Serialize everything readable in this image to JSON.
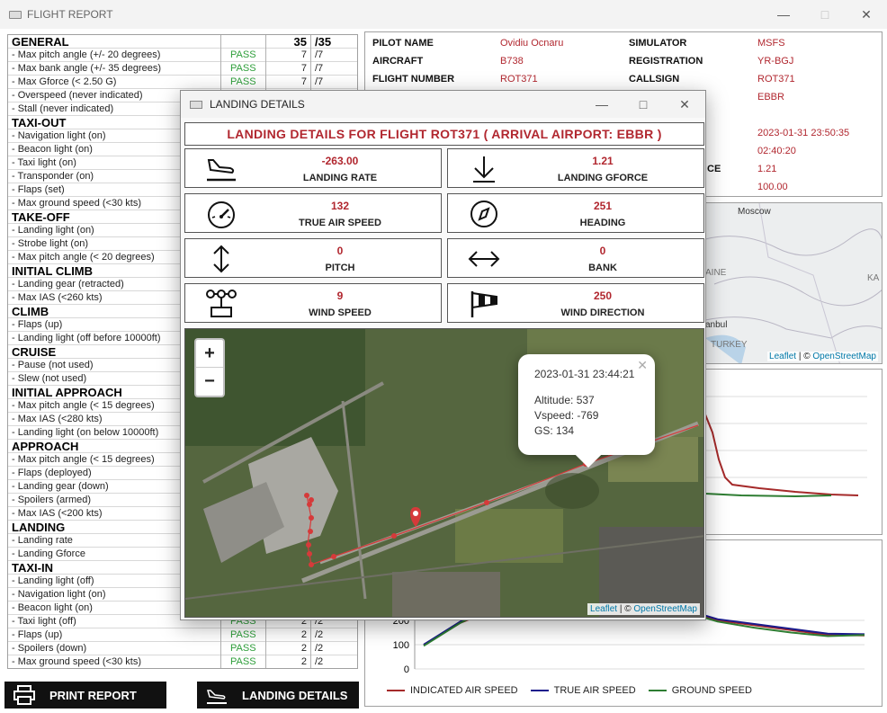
{
  "window": {
    "title": "FLIGHT REPORT"
  },
  "report": {
    "total": "35",
    "total_max": "/35",
    "rows": [
      {
        "t": "hdr",
        "label": "GENERAL",
        "res": "",
        "val": "35",
        "max": "/35"
      },
      {
        "t": "row",
        "label": " - Max pitch angle (+/- 20 degrees)",
        "res": "PASS",
        "val": "7",
        "max": "/7"
      },
      {
        "t": "row",
        "label": " - Max bank angle (+/- 35 degrees)",
        "res": "PASS",
        "val": "7",
        "max": "/7"
      },
      {
        "t": "row",
        "label": " - Max Gforce (< 2.50 G)",
        "res": "PASS",
        "val": "7",
        "max": "/7"
      },
      {
        "t": "row",
        "label": " - Overspeed (never indicated)",
        "res": "",
        "val": "",
        "max": ""
      },
      {
        "t": "row",
        "label": " - Stall (never indicated)",
        "res": "",
        "val": "",
        "max": ""
      },
      {
        "t": "hdr",
        "label": "TAXI-OUT",
        "res": "",
        "val": "",
        "max": ""
      },
      {
        "t": "row",
        "label": " - Navigation light (on)",
        "res": "",
        "val": "",
        "max": ""
      },
      {
        "t": "row",
        "label": " - Beacon light (on)",
        "res": "",
        "val": "",
        "max": ""
      },
      {
        "t": "row",
        "label": " - Taxi light (on)",
        "res": "",
        "val": "",
        "max": ""
      },
      {
        "t": "row",
        "label": " - Transponder (on)",
        "res": "",
        "val": "",
        "max": ""
      },
      {
        "t": "row",
        "label": " - Flaps (set)",
        "res": "",
        "val": "",
        "max": ""
      },
      {
        "t": "row",
        "label": " - Max ground speed (<30 kts)",
        "res": "",
        "val": "",
        "max": ""
      },
      {
        "t": "hdr",
        "label": "TAKE-OFF",
        "res": "",
        "val": "",
        "max": ""
      },
      {
        "t": "row",
        "label": " - Landing light (on)",
        "res": "",
        "val": "",
        "max": ""
      },
      {
        "t": "row",
        "label": " - Strobe light (on)",
        "res": "",
        "val": "",
        "max": ""
      },
      {
        "t": "row",
        "label": " - Max pitch angle (< 20 degrees)",
        "res": "",
        "val": "",
        "max": ""
      },
      {
        "t": "hdr",
        "label": "INITIAL CLIMB",
        "res": "",
        "val": "",
        "max": ""
      },
      {
        "t": "row",
        "label": " - Landing gear (retracted)",
        "res": "",
        "val": "",
        "max": ""
      },
      {
        "t": "row",
        "label": " - Max IAS (<260 kts)",
        "res": "",
        "val": "",
        "max": ""
      },
      {
        "t": "hdr",
        "label": "CLIMB",
        "res": "",
        "val": "",
        "max": ""
      },
      {
        "t": "row",
        "label": " - Flaps (up)",
        "res": "",
        "val": "",
        "max": ""
      },
      {
        "t": "row",
        "label": " - Landing light (off before 10000ft)",
        "res": "",
        "val": "",
        "max": ""
      },
      {
        "t": "hdr",
        "label": "CRUISE",
        "res": "",
        "val": "",
        "max": ""
      },
      {
        "t": "row",
        "label": " - Pause (not used)",
        "res": "",
        "val": "",
        "max": ""
      },
      {
        "t": "row",
        "label": " - Slew (not used)",
        "res": "",
        "val": "",
        "max": ""
      },
      {
        "t": "hdr",
        "label": "INITIAL APPROACH",
        "res": "",
        "val": "",
        "max": ""
      },
      {
        "t": "row",
        "label": " - Max pitch angle (< 15 degrees)",
        "res": "",
        "val": "",
        "max": ""
      },
      {
        "t": "row",
        "label": " - Max IAS (<280 kts)",
        "res": "",
        "val": "",
        "max": ""
      },
      {
        "t": "row",
        "label": " - Landing light (on below 10000ft)",
        "res": "",
        "val": "",
        "max": ""
      },
      {
        "t": "hdr",
        "label": "APPROACH",
        "res": "",
        "val": "",
        "max": ""
      },
      {
        "t": "row",
        "label": " - Max pitch angle (< 15 degrees)",
        "res": "",
        "val": "",
        "max": ""
      },
      {
        "t": "row",
        "label": " - Flaps (deployed)",
        "res": "",
        "val": "",
        "max": ""
      },
      {
        "t": "row",
        "label": " - Landing gear (down)",
        "res": "",
        "val": "",
        "max": ""
      },
      {
        "t": "row",
        "label": " - Spoilers (armed)",
        "res": "",
        "val": "",
        "max": ""
      },
      {
        "t": "row",
        "label": " - Max IAS (<200 kts)",
        "res": "",
        "val": "",
        "max": ""
      },
      {
        "t": "hdr",
        "label": "LANDING",
        "res": "",
        "val": "",
        "max": ""
      },
      {
        "t": "row",
        "label": " - Landing rate",
        "res": "",
        "val": "",
        "max": ""
      },
      {
        "t": "row",
        "label": " - Landing Gforce",
        "res": "",
        "val": "",
        "max": ""
      },
      {
        "t": "hdr",
        "label": "TAXI-IN",
        "res": "",
        "val": "",
        "max": ""
      },
      {
        "t": "row",
        "label": " - Landing light (off)",
        "res": "",
        "val": "",
        "max": ""
      },
      {
        "t": "row",
        "label": " - Navigation light (on)",
        "res": "",
        "val": "",
        "max": ""
      },
      {
        "t": "row",
        "label": " - Beacon light (on)",
        "res": "",
        "val": "",
        "max": ""
      },
      {
        "t": "row",
        "label": " - Taxi light (off)",
        "res": "PASS",
        "val": "2",
        "max": "/2"
      },
      {
        "t": "row",
        "label": " - Flaps (up)",
        "res": "PASS",
        "val": "2",
        "max": "/2"
      },
      {
        "t": "row",
        "label": " - Spoilers (down)",
        "res": "PASS",
        "val": "2",
        "max": "/2"
      },
      {
        "t": "row",
        "label": " - Max ground speed (<30 kts)",
        "res": "PASS",
        "val": "2",
        "max": "/2"
      }
    ]
  },
  "buttons": {
    "print": "PRINT REPORT",
    "landing": "LANDING DETAILS"
  },
  "info": {
    "pilot_label": "PILOT NAME",
    "pilot": "Ovidiu Ocnaru",
    "aircraft_label": "AIRCRAFT",
    "aircraft": "B738",
    "flight_label": "FLIGHT NUMBER",
    "flight": "ROT371",
    "sim_label": "SIMULATOR",
    "sim": "MSFS",
    "reg_label": "REGISTRATION",
    "reg": "YR-BGJ",
    "callsign_label": "CALLSIGN",
    "callsign": "ROT371",
    "arr": "EBBR",
    "date": "2023-01-31 23:50:35",
    "duration": "02:40:20",
    "gforce_label_tail": "CE",
    "gforce": "1.21",
    "score": "100.00"
  },
  "bgmap": {
    "city1": "Moscow",
    "city2": "AINE",
    "city3": "KA",
    "city4": "anbul",
    "city5": "TURKEY",
    "attr_leaflet": "Leaflet",
    "attr_sep": " | © ",
    "attr_osm": "OpenStreetMap"
  },
  "legend": {
    "ias": "INDICATED AIR SPEED",
    "tas": "TRUE AIR SPEED",
    "gs": "GROUND SPEED"
  },
  "colors": {
    "ias": "#a52a2a",
    "tas": "#1a1a8c",
    "gs": "#2e7d32",
    "accent": "#b1272f"
  },
  "chart_data": {
    "type": "line",
    "ylim": [
      0,
      800
    ],
    "yticks_visible": [
      "0",
      "100",
      "200"
    ],
    "series": [
      {
        "name": "INDICATED AIR SPEED",
        "values": [
          100,
          190,
          250,
          260,
          260,
          255,
          250,
          240,
          200,
          180,
          160,
          140,
          138
        ]
      },
      {
        "name": "TRUE AIR SPEED",
        "values": [
          100,
          195,
          270,
          300,
          320,
          310,
          290,
          250,
          205,
          185,
          165,
          145,
          143
        ]
      },
      {
        "name": "GROUND SPEED",
        "values": [
          95,
          190,
          265,
          295,
          315,
          300,
          280,
          240,
          195,
          170,
          150,
          135,
          140
        ]
      }
    ]
  },
  "modal": {
    "title": "LANDING DETAILS",
    "heading": "LANDING DETAILS FOR FLIGHT ROT371 ( ARRIVAL AIRPORT: EBBR )",
    "cards": [
      {
        "value": "-263.00",
        "label": "LANDING RATE",
        "icon": "plane-landing-icon"
      },
      {
        "value": "1.21",
        "label": "LANDING GFORCE",
        "icon": "arrow-down-icon"
      },
      {
        "value": "132",
        "label": "TRUE AIR SPEED",
        "icon": "speedometer-icon"
      },
      {
        "value": "251",
        "label": "HEADING",
        "icon": "compass-icon"
      },
      {
        "value": "0",
        "label": "PITCH",
        "icon": "vertical-arrows-icon"
      },
      {
        "value": "0",
        "label": "BANK",
        "icon": "horizontal-arrows-icon"
      },
      {
        "value": "9",
        "label": "WIND SPEED",
        "icon": "anemometer-icon"
      },
      {
        "value": "250",
        "label": "WIND DIRECTION",
        "icon": "windsock-icon"
      }
    ],
    "popup": {
      "time": "2023-01-31 23:44:21",
      "alt": "Altitude: 537",
      "vs": "Vspeed: -769",
      "gs": "GS: 134"
    },
    "attr_leaflet": "Leaflet",
    "attr_sep": " | © ",
    "attr_osm": "OpenStreetMap",
    "zoom_in": "+",
    "zoom_out": "−"
  }
}
